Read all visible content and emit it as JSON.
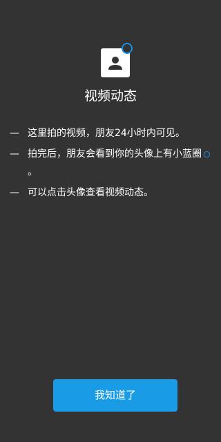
{
  "colors": {
    "background": "#333333",
    "accent": "#1a9be6",
    "text": "#ffffff"
  },
  "header": {
    "icon": "contact-avatar-icon",
    "badge_icon": "ring-indicator-icon",
    "title": "视频动态"
  },
  "tips": [
    {
      "bullet": "—",
      "text": "这里拍的视频，朋友24小时内可见。"
    },
    {
      "bullet": "—",
      "text": "拍完后，朋友会看到你的头像上有小蓝圈",
      "suffix": "。",
      "inline_icon": "blue-ring-icon"
    },
    {
      "bullet": "—",
      "text": "可以点击头像查看视频动态。"
    }
  ],
  "confirm_button": {
    "label": "我知道了"
  }
}
